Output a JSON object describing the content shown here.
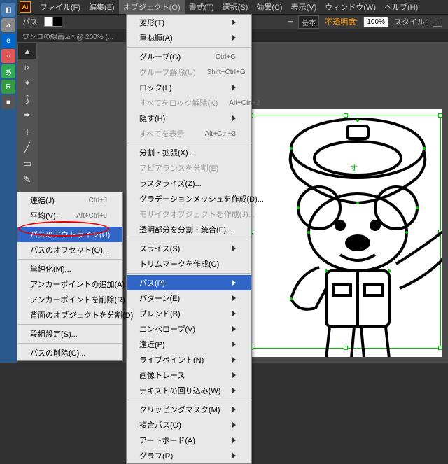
{
  "menubar": {
    "items": [
      "ファイル(F)",
      "編集(E)",
      "オブジェクト(O)",
      "書式(T)",
      "選択(S)",
      "効果(C)",
      "表示(V)",
      "ウィンドウ(W)",
      "ヘルプ(H)"
    ]
  },
  "optbar": {
    "label": "パス",
    "basic": "基本",
    "opacity_label": "不透明度:",
    "opacity": "100%",
    "style_label": "スタイル:"
  },
  "doctab": "ワンコの線画.ai* @ 200% (...",
  "menu1": [
    {
      "t": "変形(T)",
      "sub": true
    },
    {
      "t": "重ね順(A)",
      "sub": true
    },
    {
      "sep": true
    },
    {
      "t": "グループ(G)",
      "sc": "Ctrl+G"
    },
    {
      "t": "グループ解除(U)",
      "sc": "Shift+Ctrl+G",
      "d": true
    },
    {
      "t": "ロック(L)",
      "sub": true
    },
    {
      "t": "すべてをロック解除(K)",
      "sc": "Alt+Ctrl+2",
      "d": true
    },
    {
      "t": "隠す(H)",
      "sub": true
    },
    {
      "t": "すべてを表示",
      "sc": "Alt+Ctrl+3",
      "d": true
    },
    {
      "sep": true
    },
    {
      "t": "分割・拡張(X)..."
    },
    {
      "t": "アピアランスを分割(E)",
      "d": true
    },
    {
      "t": "ラスタライズ(Z)..."
    },
    {
      "t": "グラデーションメッシュを作成(D)..."
    },
    {
      "t": "モザイクオブジェクトを作成(J)...",
      "d": true
    },
    {
      "t": "透明部分を分割・統合(F)..."
    },
    {
      "sep": true
    },
    {
      "t": "スライス(S)",
      "sub": true
    },
    {
      "t": "トリムマークを作成(C)"
    },
    {
      "sep": true
    },
    {
      "t": "パス(P)",
      "sub": true,
      "hl": true
    },
    {
      "t": "パターン(E)",
      "sub": true
    },
    {
      "t": "ブレンド(B)",
      "sub": true
    },
    {
      "t": "エンベロープ(V)",
      "sub": true
    },
    {
      "t": "遠近(P)",
      "sub": true
    },
    {
      "t": "ライブペイント(N)",
      "sub": true
    },
    {
      "t": "画像トレース",
      "sub": true
    },
    {
      "t": "テキストの回り込み(W)",
      "sub": true
    },
    {
      "sep": true
    },
    {
      "t": "クリッピングマスク(M)",
      "sub": true
    },
    {
      "t": "複合パス(O)",
      "sub": true
    },
    {
      "t": "アートボード(A)",
      "sub": true
    },
    {
      "t": "グラフ(R)",
      "sub": true
    }
  ],
  "menu2": [
    {
      "t": "連結(J)",
      "sc": "Ctrl+J"
    },
    {
      "t": "平均(V)...",
      "sc": "Alt+Ctrl+J"
    },
    {
      "sep": true
    },
    {
      "t": "パスのアウトライン(U)",
      "hl": true
    },
    {
      "t": "パスのオフセット(O)..."
    },
    {
      "sep": true
    },
    {
      "t": "単純化(M)..."
    },
    {
      "t": "アンカーポイントの追加(A)"
    },
    {
      "t": "アンカーポイントを削除(R)"
    },
    {
      "t": "背面のオブジェクトを分割(D)"
    },
    {
      "sep": true
    },
    {
      "t": "段組設定(S)..."
    },
    {
      "sep": true
    },
    {
      "t": "パスの削除(C)..."
    }
  ]
}
